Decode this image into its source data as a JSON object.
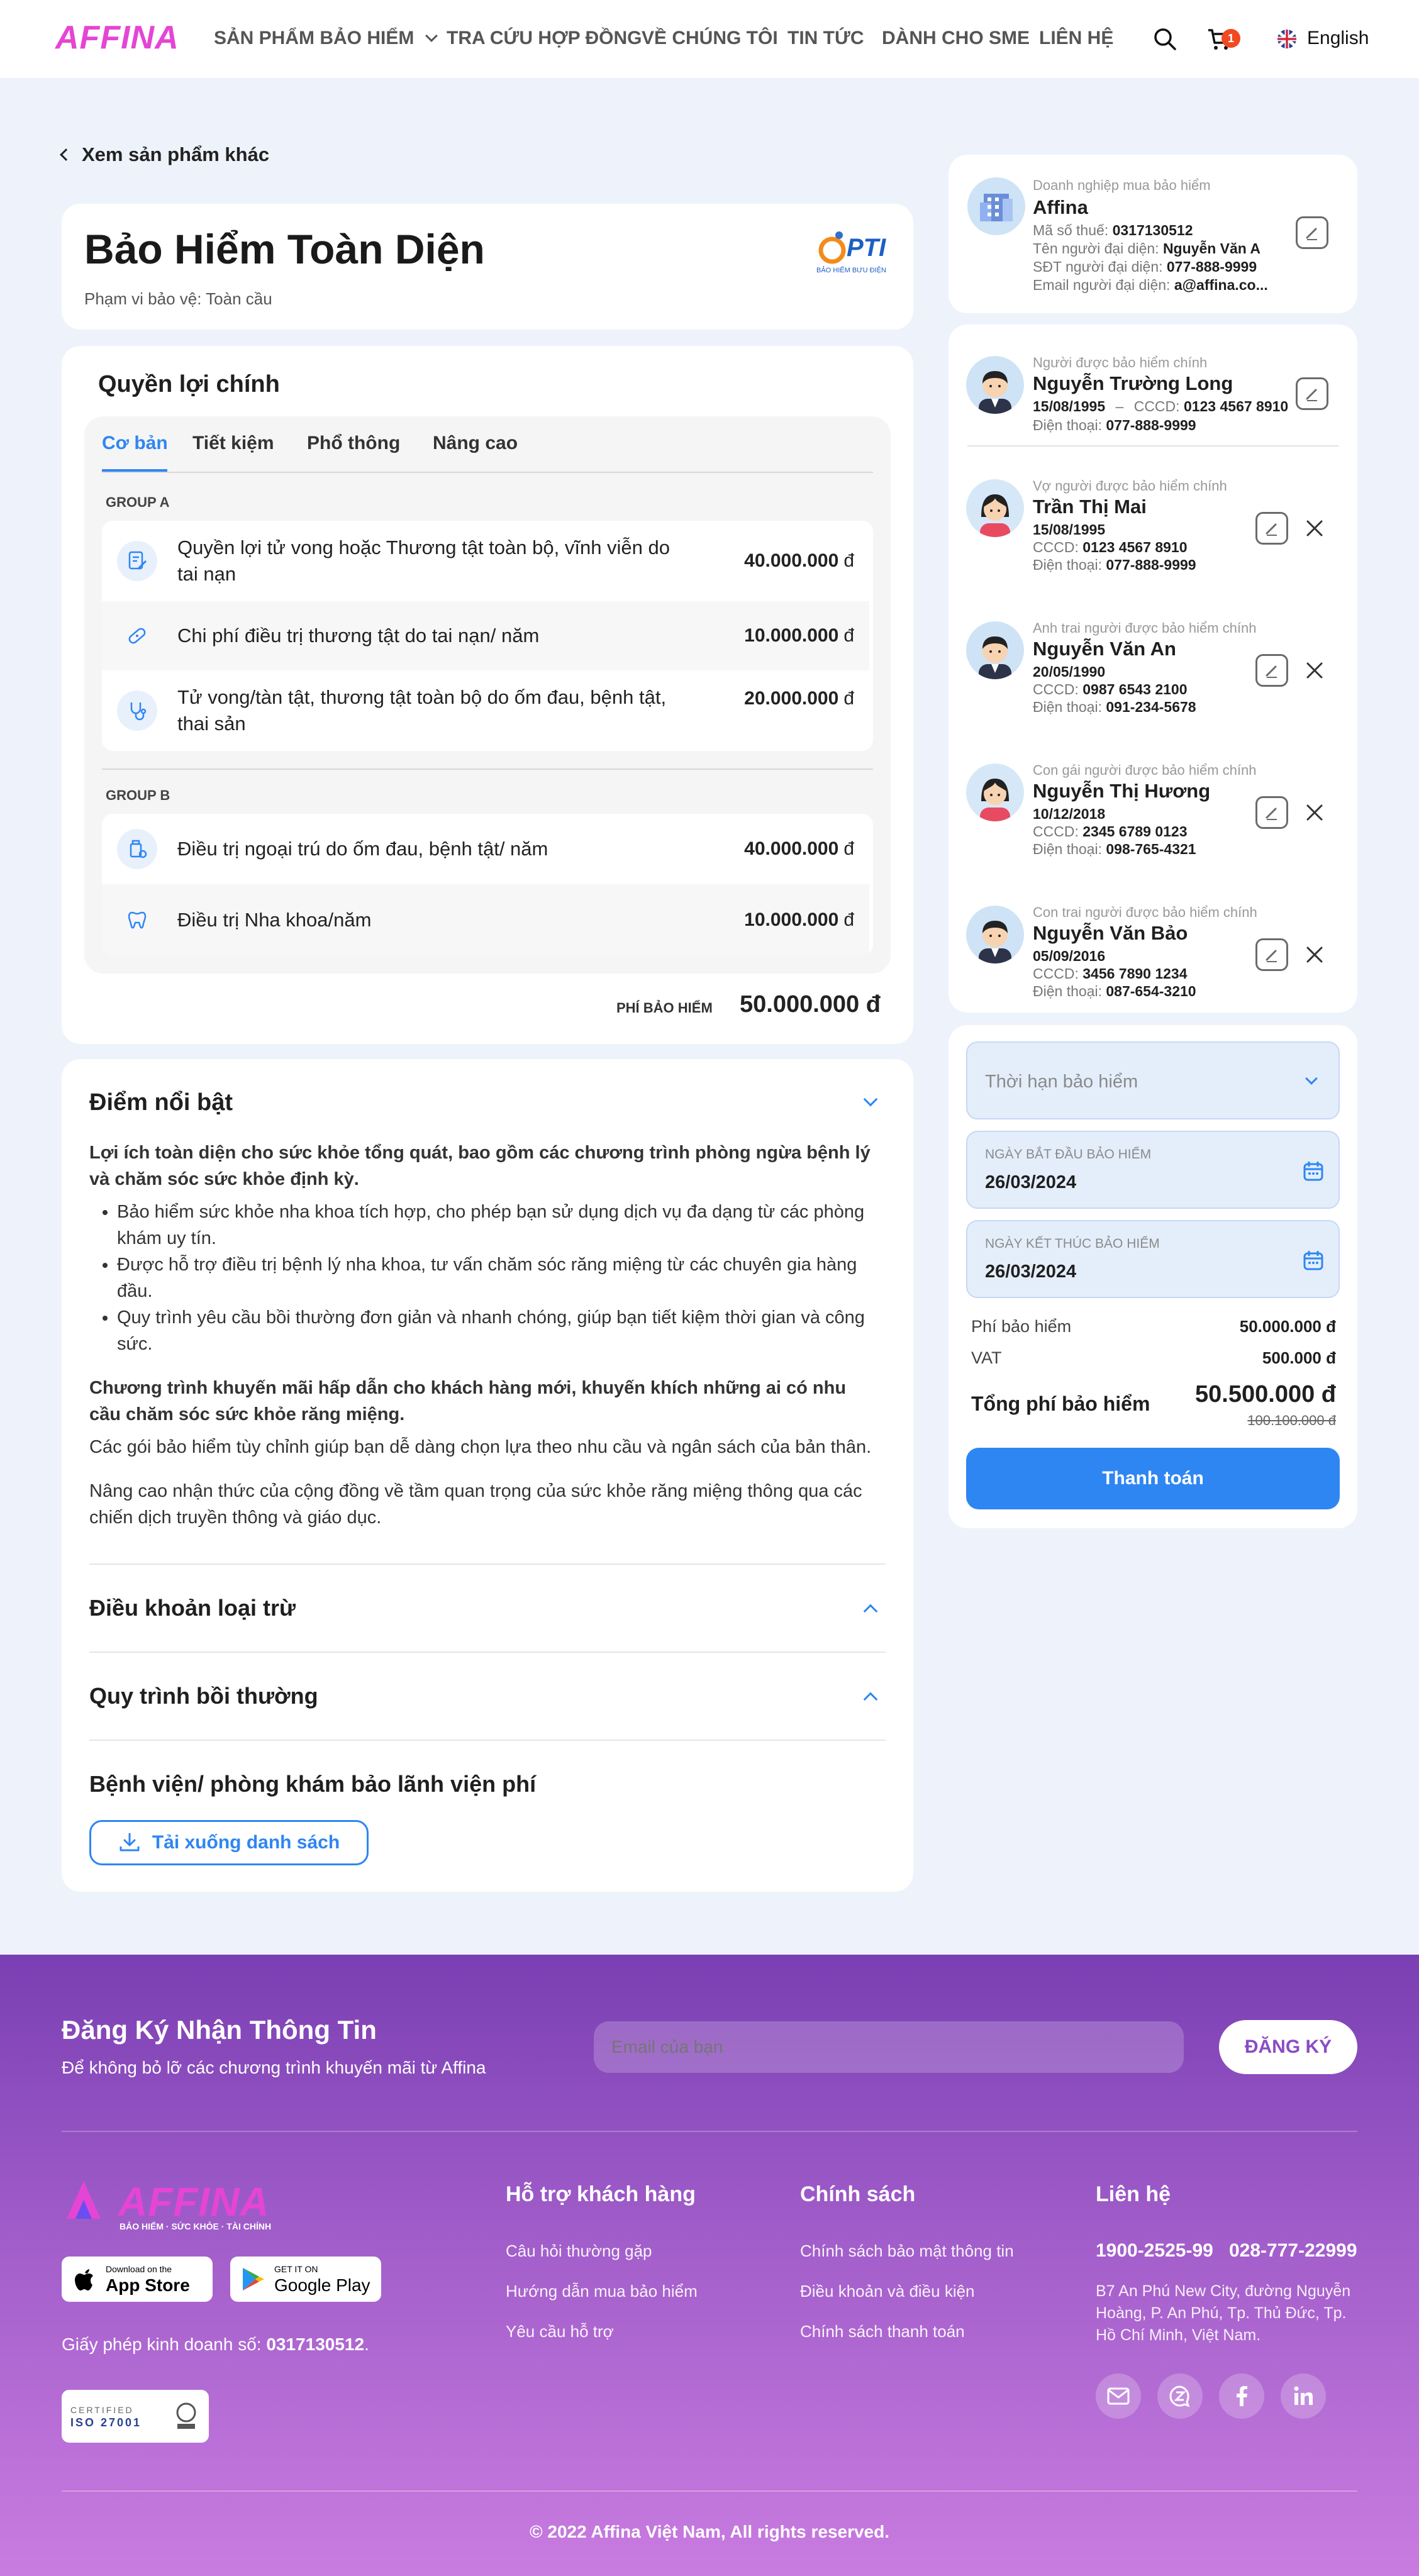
{
  "brand": {
    "logo_text": "AFFINA",
    "tagline": "BẢO HIỂM · SỨC KHỎE · TÀI CHÍNH"
  },
  "nav": {
    "items": [
      "SẢN PHẨM BẢO HIỂM",
      "TRA CỨU HỢP ĐỒNG",
      "VỀ CHÚNG TÔI",
      "TIN TỨC",
      "DÀNH CHO SME",
      "LIÊN HỆ"
    ],
    "cart_count": "1",
    "language": "English"
  },
  "back_link": "Xem sản phẩm khác",
  "product": {
    "title": "Bảo Hiểm Toàn Diện",
    "scope": "Phạm vi bảo vệ: Toàn cầu",
    "insurer_logo": "PTI",
    "insurer_sub": "BẢO HIỂM BƯU ĐIỆN"
  },
  "benefits": {
    "heading": "Quyền lợi chính",
    "tabs": [
      "Cơ bản",
      "Tiết kiệm",
      "Phổ thông",
      "Nâng cao"
    ],
    "active_tab": "Cơ bản",
    "groups": [
      {
        "name": "GROUP A",
        "rows": [
          {
            "icon": "document-pen-icon",
            "text": "Quyền lợi tử vong hoặc Thương tật toàn bộ, vĩnh viễn do tai nạn",
            "value": "40.000.000",
            "unit": "đ"
          },
          {
            "icon": "bandage-icon",
            "text": "Chi phí điều trị thương tật do tai nạn/ năm",
            "value": "10.000.000",
            "unit": "đ"
          },
          {
            "icon": "stethoscope-icon",
            "text": "Tử vong/tàn tật, thương tật toàn bộ do ốm đau, bệnh tật, thai sản",
            "value": "20.000.000",
            "unit": "đ"
          }
        ]
      },
      {
        "name": "GROUP B",
        "rows": [
          {
            "icon": "medicine-icon",
            "text": "Điều trị ngoại trú do ốm đau, bệnh tật/ năm",
            "value": "40.000.000",
            "unit": "đ"
          },
          {
            "icon": "tooth-icon",
            "text": "Điều trị Nha khoa/năm",
            "value": "10.000.000",
            "unit": "đ"
          }
        ]
      }
    ],
    "premium_label": "PHÍ BẢO HIỂM",
    "premium_value": "50.000.000 đ"
  },
  "highlights": {
    "heading": "Điểm nổi bật",
    "lead": "Lợi ích toàn diện cho sức khỏe tổng quát, bao gồm các chương trình phòng ngừa bệnh lý và chăm sóc sức khỏe định kỳ.",
    "bullets": [
      "Bảo hiểm sức khỏe nha khoa tích hợp, cho phép bạn sử dụng dịch vụ đa dạng từ các phòng khám uy tín.",
      "Được hỗ trợ điều trị bệnh lý nha khoa, tư vấn chăm sóc răng miệng từ các chuyên gia hàng đầu.",
      "Quy trình yêu cầu bồi thường đơn giản và nhanh chóng, giúp bạn tiết kiệm thời gian và công sức."
    ],
    "lead2": "Chương trình khuyến mãi hấp dẫn cho khách hàng mới, khuyến khích những ai có nhu cầu chăm sóc sức khỏe răng miệng.",
    "para1": "Các gói bảo hiểm tùy chỉnh giúp bạn dễ dàng chọn lựa theo nhu cầu và ngân sách của bản thân.",
    "para2": "Nâng cao nhận thức của cộng đồng về tầm quan trọng của sức khỏe răng miệng thông qua các chiến dịch truyền thông và giáo dục."
  },
  "sections": {
    "exclusions": "Điều khoản loại trừ",
    "claims": "Quy trình bồi thường",
    "hospitals": "Bệnh viện/ phòng khám bảo lãnh viện phí",
    "download": "Tải xuống danh sách"
  },
  "company": {
    "label": "Doanh nghiệp mua bảo hiểm",
    "name": "Affina",
    "tax_label": "Mã số thuế:",
    "tax": "0317130512",
    "rep_label": "Tên người đại diện:",
    "rep": "Nguyễn Văn A",
    "phone_label": "SĐT người đại diện:",
    "phone": "077-888-9999",
    "email_label": "Email người đại diện:",
    "email": "a@affina.co..."
  },
  "insured": [
    {
      "relation": "Người được bảo hiểm chính",
      "name": "Nguyễn Trường Long",
      "dob": "15/08/1995",
      "sep": "–",
      "id_label": "CCCD:",
      "id": "0123 4567 8910",
      "phone_label": "Điện thoại:",
      "phone": "077-888-9999"
    },
    {
      "relation": "Vợ người được bảo hiểm chính",
      "name": "Trần Thị Mai",
      "dob": "15/08/1995",
      "id_label": "CCCD:",
      "id": "0123 4567 8910",
      "phone_label": "Điện thoại:",
      "phone": "077-888-9999"
    },
    {
      "relation": "Anh trai người được bảo hiểm chính",
      "name": "Nguyễn Văn An",
      "dob": "20/05/1990",
      "id_label": "CCCD:",
      "id": "0987 6543 2100",
      "phone_label": "Điện thoại:",
      "phone": "091-234-5678"
    },
    {
      "relation": "Con gái người được bảo hiểm chính",
      "name": "Nguyễn Thị Hương",
      "dob": "10/12/2018",
      "id_label": "CCCD:",
      "id": "2345 6789 0123",
      "phone_label": "Điện thoại:",
      "phone": "098-765-4321"
    },
    {
      "relation": "Con trai người được bảo hiểm chính",
      "name": "Nguyễn Văn Bảo",
      "dob": "05/09/2016",
      "id_label": "CCCD:",
      "id": "3456 7890 1234",
      "phone_label": "Điện thoại:",
      "phone": "087-654-3210"
    }
  ],
  "payment": {
    "term_placeholder": "Thời hạn bảo hiểm",
    "start_label": "NGÀY BẮT ĐẦU BẢO HIỂM",
    "start_value": "26/03/2024",
    "end_label": "NGÀY KẾT THÚC BẢO HIỂM",
    "end_value": "26/03/2024",
    "fee_label": "Phí bảo hiểm",
    "fee_value": "50.000.000 đ",
    "vat_label": "VAT",
    "vat_value": "500.000 đ",
    "total_label": "Tổng phí bảo hiểm",
    "total_value": "50.500.000 đ",
    "total_old": "100.100.000 đ",
    "pay_button": "Thanh toán"
  },
  "newsletter": {
    "title": "Đăng Ký Nhận Thông Tin",
    "subtitle": "Để không bỏ lỡ các chương trình khuyến mãi từ Affina",
    "placeholder": "Email của bạn",
    "button": "ĐĂNG KÝ"
  },
  "footer": {
    "app_store_small": "Download on the",
    "app_store": "App Store",
    "google_small": "GET IT ON",
    "google": "Google Play",
    "license_prefix": "Giấy phép kinh doanh số:",
    "license": "0317130512",
    "iso_small": "CERTIFIED",
    "iso": "ISO 27001",
    "support_title": "Hỗ trợ khách hàng",
    "support_links": [
      "Câu hỏi thường gặp",
      "Hướng dẫn mua bảo hiểm",
      "Yêu cầu hỗ trợ"
    ],
    "policy_title": "Chính sách",
    "policy_links": [
      "Chính sách bảo mật thông tin",
      "Điều khoản và điều kiện",
      "Chính sách thanh toán"
    ],
    "contact_title": "Liên hệ",
    "hotline1": "1900-2525-99",
    "hotline2": "028-777-22999",
    "address": "B7 An Phú New City, đường Nguyễn Hoàng, P. An Phú, Tp. Thủ Đức, Tp. Hồ Chí Minh, Việt Nam.",
    "copyright": "© 2022 Affina Việt Nam, All rights reserved."
  },
  "colors": {
    "brand_pink": "#e545d4",
    "accent_blue": "#2e86f3",
    "footer_top": "#7a3fb3",
    "footer_bottom": "#c97ce0"
  }
}
